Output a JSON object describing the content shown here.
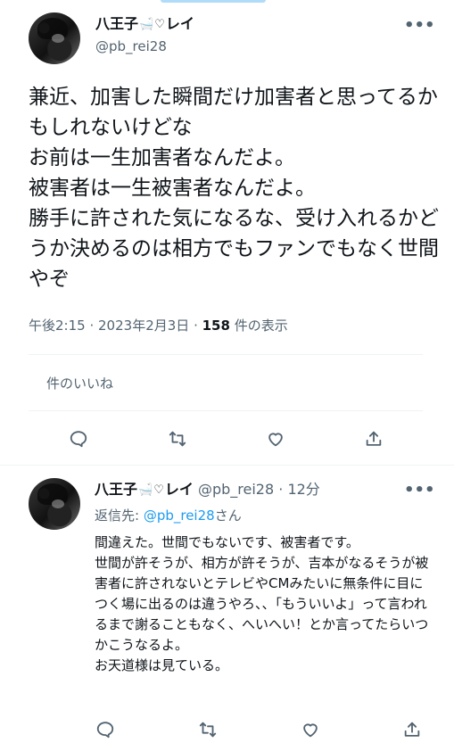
{
  "tweet": {
    "display_name": "八王子",
    "name_suffix": "レイ",
    "handle": "@pb_rei28",
    "more_label": "•••",
    "body": "兼近、加害した瞬間だけ加害者と思ってるかもしれないけどな\nお前は一生加害者なんだよ。\n被害者は一生被害者なんだよ。\n勝手に許された気になるな、受け入れるかどうか決めるのは相方でもファンでもなく世間やぞ",
    "time": "午後2:15",
    "date": "2023年2月3日",
    "views_count": "158",
    "views_label": "件の表示",
    "likes_link": "件のいいね"
  },
  "reply": {
    "display_name": "八王子",
    "name_suffix": "レイ",
    "handle": "@pb_rei28",
    "dot": "·",
    "time": "12分",
    "replying_prefix": "返信先: ",
    "replying_handle": "@pb_rei28",
    "replying_suffix": "さん",
    "body": "間違えた。世間でもないです、被害者です。\n世間が許そうが、相方が許そうが、吉本がなるそうが被害者に許されないとテレビやCMみたいに無条件に目につく場に出るのは違うやろ、、「もういいよ」って言われるまで謝ることもなく、へいへい！とか言ってたらいつかこうなるよ。\nお天道様は見ている。",
    "more_label": "•••"
  },
  "icons": {
    "reply": "reply-bubble-icon",
    "retweet": "retweet-icon",
    "like": "heart-icon",
    "share": "share-upload-icon",
    "bathtub": "bathtub-emoji-icon",
    "heart_outline": "heart-outline-emoji-icon"
  },
  "colors": {
    "text": "#0f1419",
    "secondary": "#536471",
    "link": "#1d9bf0",
    "divider": "#eff3f4"
  }
}
